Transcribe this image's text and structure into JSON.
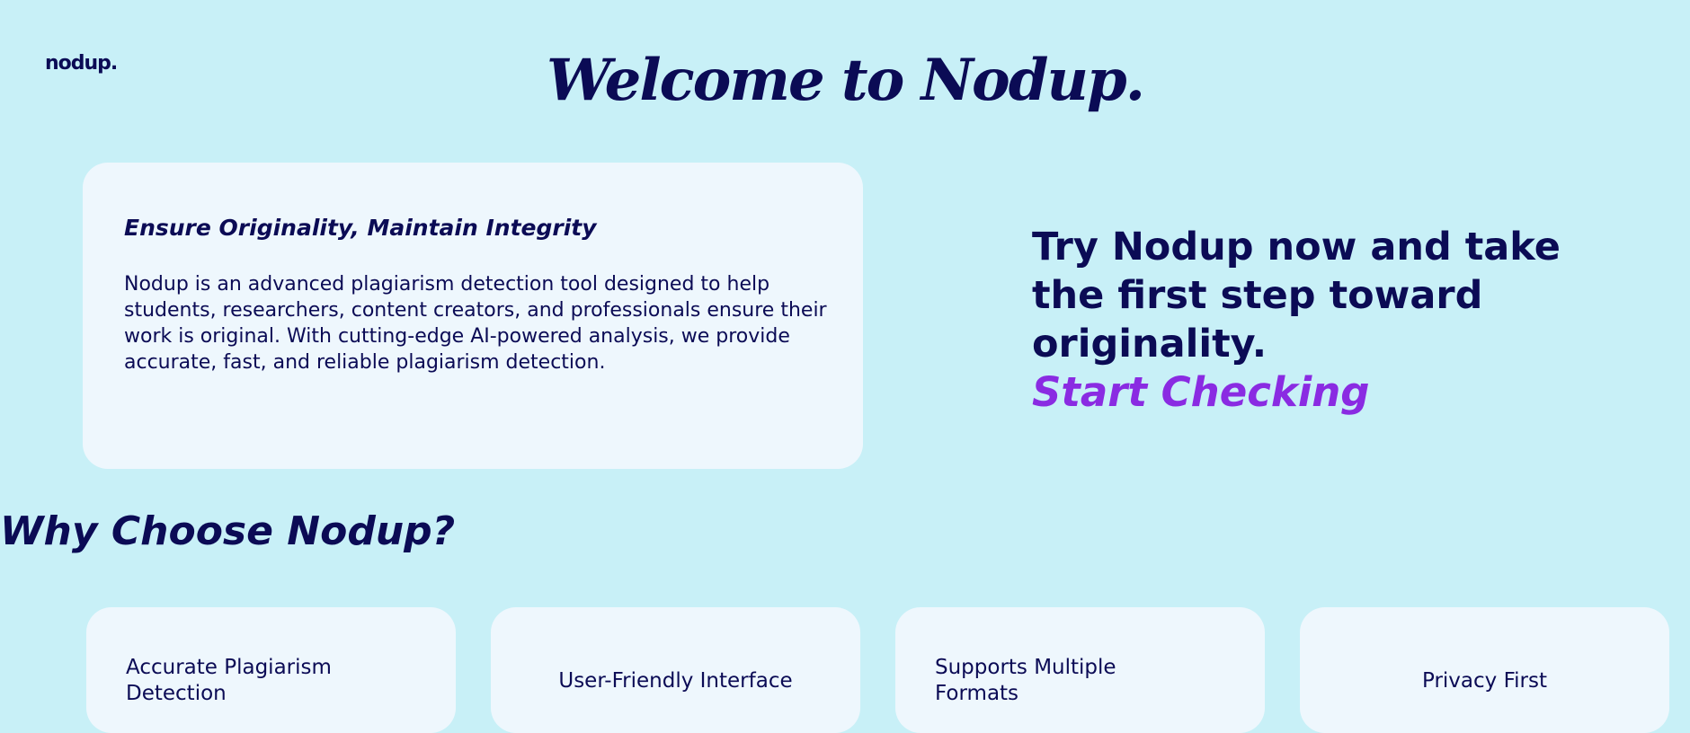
{
  "header": {
    "logo_text": "nodup.",
    "welcome_title": "Welcome to Nodup."
  },
  "intro": {
    "heading": "Ensure Originality, Maintain Integrity",
    "body": "Nodup is an advanced plagiarism detection tool designed to help students, researchers, content creators, and professionals ensure their work is original. With cutting-edge AI-powered analysis, we provide accurate, fast, and reliable plagiarism detection."
  },
  "cta": {
    "text": "Try Nodup now and take the first step toward originality.",
    "link_label": "Start Checking",
    "link_color": "#8a2be2"
  },
  "why": {
    "heading": "Why Choose Nodup?",
    "features": [
      {
        "title": "Accurate Plagiarism Detection"
      },
      {
        "title": "User-Friendly Interface"
      },
      {
        "title": "Supports Multiple Formats"
      },
      {
        "title": "Privacy First"
      }
    ]
  },
  "colors": {
    "background": "#c8f0f7",
    "card": "#eef7fd",
    "text": "#0b0b55",
    "accent": "#8a2be2"
  }
}
